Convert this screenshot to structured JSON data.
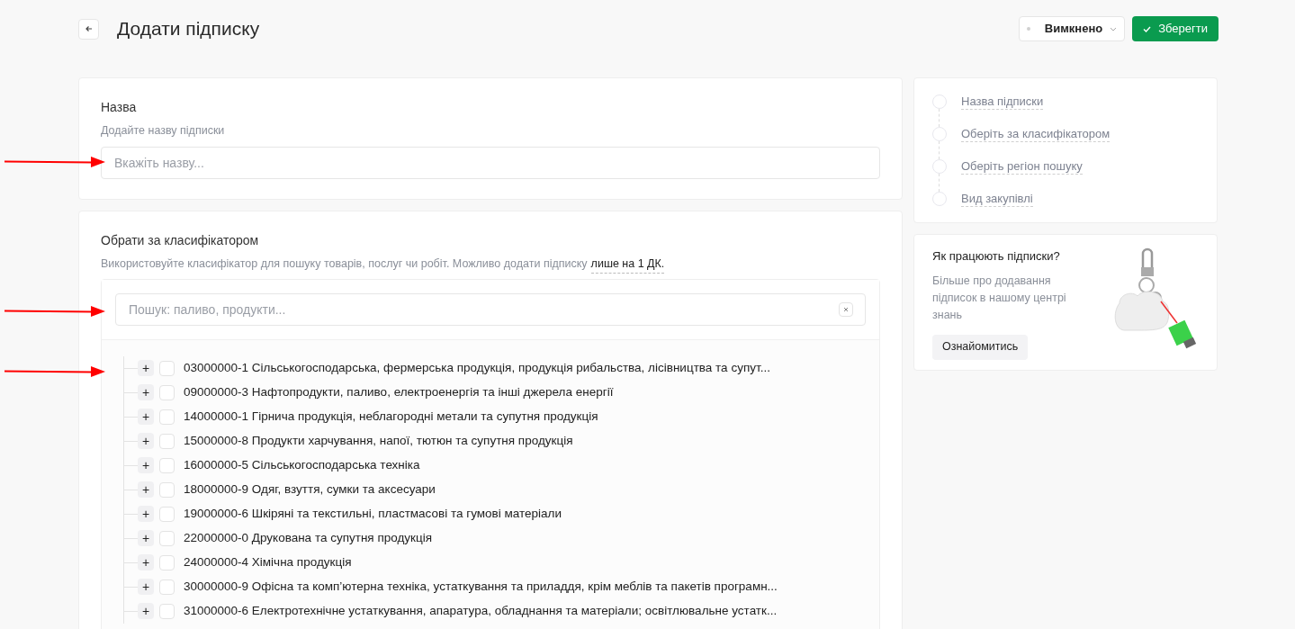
{
  "header": {
    "title": "Додати підписку",
    "status": "Вимкнено",
    "save_button": "Зберегти"
  },
  "name_section": {
    "title": "Назва",
    "hint": "Додайте назву підписки",
    "placeholder": "Вкажіть назву..."
  },
  "classifier_section": {
    "title": "Обрати за класифікатором",
    "hint": "Використовуйте класифікатор для пошуку товарів, послуг чи робіт. Можливо додати підписку",
    "hint_link": "лише на 1 ДК.",
    "search": {
      "placeholder": "Пошук: паливо, продукти..."
    },
    "tree": [
      {
        "expander": "+",
        "checked": false,
        "label": "03000000-1 Сільськогосподарська, фермерська продукція, продукція рибальства, лісівництва та супут..."
      },
      {
        "expander": "+",
        "checked": false,
        "label": "09000000-3 Нафтопродукти, паливо, електроенергія та інші джерела енергії"
      },
      {
        "expander": "+",
        "checked": false,
        "label": "14000000-1 Гірнича продукція, неблагородні метали та супутня продукція"
      },
      {
        "expander": "+",
        "checked": false,
        "label": "15000000-8 Продукти харчування, напої, тютюн та супутня продукція"
      },
      {
        "expander": "+",
        "checked": false,
        "label": "16000000-5 Сільськогосподарська техніка"
      },
      {
        "expander": "+",
        "checked": false,
        "label": "18000000-9 Одяг, взуття, сумки та аксесуари"
      },
      {
        "expander": "+",
        "checked": false,
        "label": "19000000-6 Шкіряні та текстильні, пластмасові та гумові матеріали"
      },
      {
        "expander": "+",
        "checked": false,
        "label": "22000000-0 Друкована та супутня продукція"
      },
      {
        "expander": "+",
        "checked": false,
        "label": "24000000-4 Хімічна продукція"
      },
      {
        "expander": "+",
        "checked": false,
        "label": "30000000-9 Офісна та комп’ютерна техніка, устаткування та приладдя, крім меблів та пакетів програмн..."
      },
      {
        "expander": "+",
        "checked": false,
        "label": "31000000-6 Електротехнічне устаткування, апаратура, обладнання та матеріали; освітлювальне устатк..."
      }
    ]
  },
  "steps": [
    {
      "label": "Назва підписки",
      "done": false
    },
    {
      "label": "Оберіть за класифікатором",
      "done": false
    },
    {
      "label": "Оберіть регіон пошуку",
      "done": false
    },
    {
      "label": "Вид закупівлі",
      "done": false
    }
  ],
  "help_card": {
    "title": "Як працюють підписки?",
    "text": "Більше про додавання підписок в нашому центрі знань",
    "button": "Ознайомитись"
  }
}
